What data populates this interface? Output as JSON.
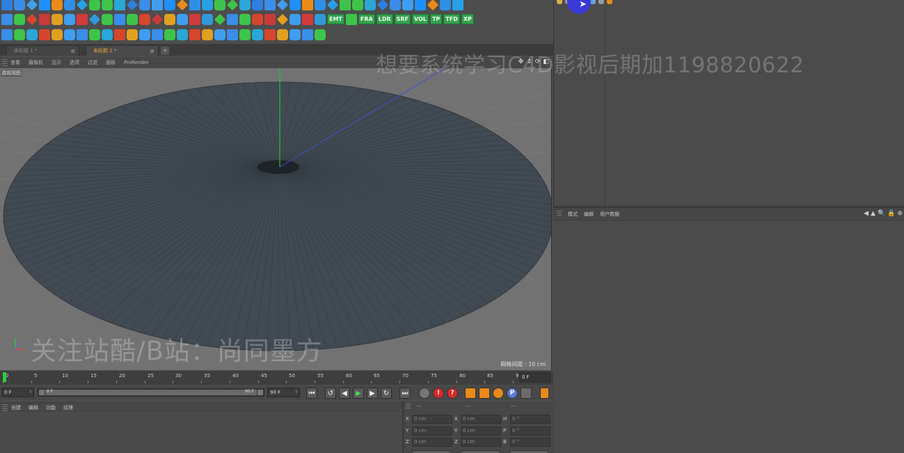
{
  "toolbar": {
    "row1_icons": [
      "object-icon",
      "sphere-icon",
      "cube-icon",
      "cylinder-icon",
      "cone-icon",
      "render-settings-icon",
      "spline-icon",
      "nurbs-icon",
      "particle-icon",
      "deformer-icon",
      "effector-icon",
      "field-icon",
      "scene-icon",
      "light-icon",
      "camera-icon",
      "tag-icon",
      "mograph-icon",
      "cloner-icon",
      "fracture-icon",
      "matrix-icon",
      "voronoi-icon",
      "inheritance-icon",
      "volume-icon",
      "shader-icon",
      "formula-icon",
      "delay-icon",
      "push-apart-icon",
      "random-icon",
      "step-icon",
      "time-icon",
      "plain-icon",
      "target-icon",
      "group-icon",
      "sound-icon",
      "python-icon",
      "reeffector-icon",
      "spline-wrap-icon",
      "tracer-icon",
      "motion-text-icon",
      "extrude-icon",
      "xref-icon"
    ],
    "row2_icons": [
      "move-icon",
      "scale-icon",
      "rotate-icon",
      "live-select-icon",
      "rect-select-icon",
      "knife-icon",
      "bevel-icon",
      "extrude-icon",
      "bridge-icon",
      "weld-icon",
      "heart-icon",
      "particle-emitter-icon",
      "boolean-icon",
      "sweep-icon",
      "lathe-icon",
      "symmetry-icon",
      "connect-icon",
      "instance-icon",
      "array-icon",
      "atom-icon",
      "polyreduce-icon",
      "metaball-icon",
      "sketch-icon",
      "hair-icon",
      "feather-icon",
      "grass-icon"
    ],
    "row2_tags": [
      "EMT",
      "FRA",
      "LDR",
      "SRF",
      "VOL",
      "TP",
      "TFD",
      "XP"
    ],
    "row3_icons": [
      "dynamics-icon",
      "connector-icon",
      "spring-icon",
      "force-icon",
      "driver-icon",
      "motor-icon",
      "rope-icon",
      "cloth-icon",
      "collider-icon",
      "soft-body-icon",
      "belt-icon",
      "brush-icon",
      "emitter-icon",
      "attractor-icon",
      "deflector-icon",
      "friction-icon",
      "gravity-icon",
      "rotation-icon",
      "turbulence-icon",
      "wind-icon",
      "text-icon",
      "tag-icon",
      "paint-icon",
      "bodypaint-icon",
      "uv-icon",
      "export-icon"
    ]
  },
  "tabs": [
    {
      "label": "未标题 1 *",
      "close": "⊗",
      "active": false
    },
    {
      "label": "未标题 2 *",
      "close": "⊗",
      "active": true
    }
  ],
  "tab_add": "+",
  "viewport_menu": [
    "查看",
    "摄像机",
    "显示",
    "选项",
    "过滤",
    "面板",
    "ProRender"
  ],
  "viewport_nav": [
    "✥",
    "⇕",
    "⟳",
    "◧"
  ],
  "viewport": {
    "label": "透视视图",
    "grid_spacing": "网格间距 : 10 cm"
  },
  "timeline": {
    "ticks": [
      "0",
      "5",
      "10",
      "15",
      "20",
      "25",
      "30",
      "35",
      "40",
      "45",
      "50",
      "55",
      "60",
      "65",
      "70",
      "75",
      "80",
      "85",
      "90"
    ],
    "end_frame": "0 F"
  },
  "transport": {
    "current_frame": "0 F",
    "slider_start": "0 F",
    "slider_end": "90 F",
    "max_frame": "90 F"
  },
  "material_menu": [
    "创建",
    "编辑",
    "功能",
    "纹理"
  ],
  "coordinates": {
    "headers": [
      "---",
      "---",
      "---"
    ],
    "rows": [
      {
        "a1": "X",
        "v1": "0 cm",
        "a2": "X",
        "v2": "0 cm",
        "a3": "H",
        "v3": "0 °"
      },
      {
        "a1": "Y",
        "v1": "0 cm",
        "a2": "Y",
        "v2": "0 cm",
        "a3": "P",
        "v3": "0 °"
      },
      {
        "a1": "Z",
        "v1": "0 cm",
        "a2": "Z",
        "v2": "0 cm",
        "a3": "B",
        "v3": "0 °"
      }
    ]
  },
  "attribute_menu": [
    "模式",
    "编辑",
    "用户数据"
  ],
  "attribute_nav": [
    "◀",
    "▲",
    "🔍",
    "🔒",
    "⊕"
  ],
  "watermarks": {
    "top": "想要系统学习C4D影视后期加1198820622",
    "bottom": "关注站酷/B站：尚同墨方"
  },
  "colors": {
    "accent_orange": "#f0a23a",
    "timeline_green": "#2ecc40",
    "tag_green": "#33a24e",
    "disc_fill": "#414a52",
    "cursor_highlight": "#3a3ad6"
  }
}
